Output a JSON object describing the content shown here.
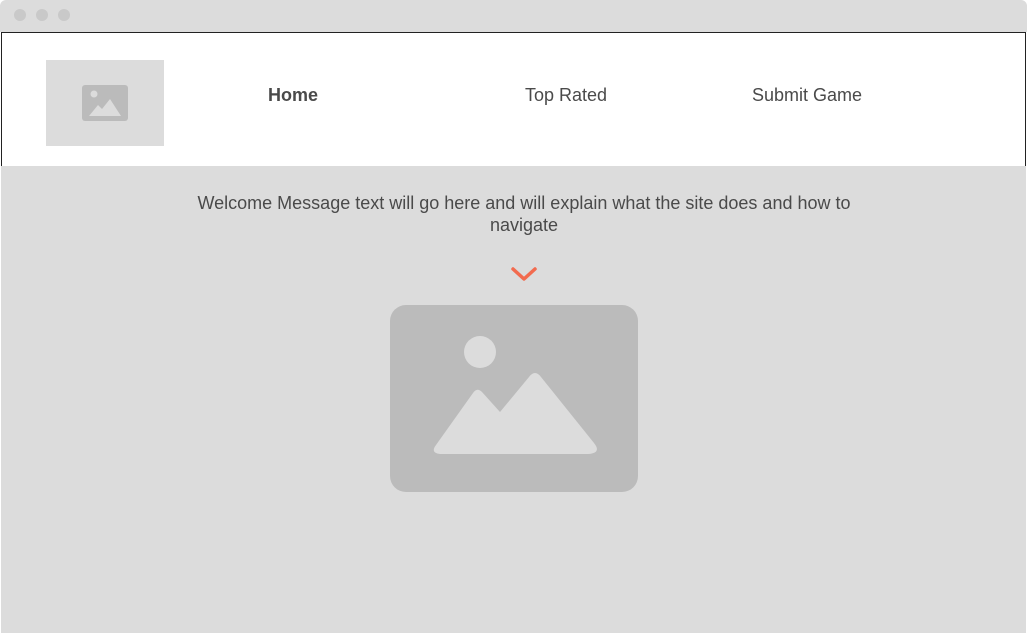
{
  "window": {
    "controls": [
      "close",
      "minimize",
      "maximize"
    ]
  },
  "header": {
    "logo_icon": "image-placeholder-icon",
    "nav": [
      {
        "label": "Home",
        "active": true
      },
      {
        "label": "Top Rated",
        "active": false
      },
      {
        "label": "Submit Game",
        "active": false
      }
    ]
  },
  "main": {
    "welcome_text": "Welcome Message text will go here and will explain what the site does and how to navigate",
    "scroll_icon": "chevron-down-icon",
    "hero_icon": "image-placeholder-icon"
  },
  "colors": {
    "accent": "#f26b4f",
    "placeholder_bg": "#dcdcdc",
    "placeholder_icon": "#bbbbbb",
    "text": "#4a4a4a"
  }
}
